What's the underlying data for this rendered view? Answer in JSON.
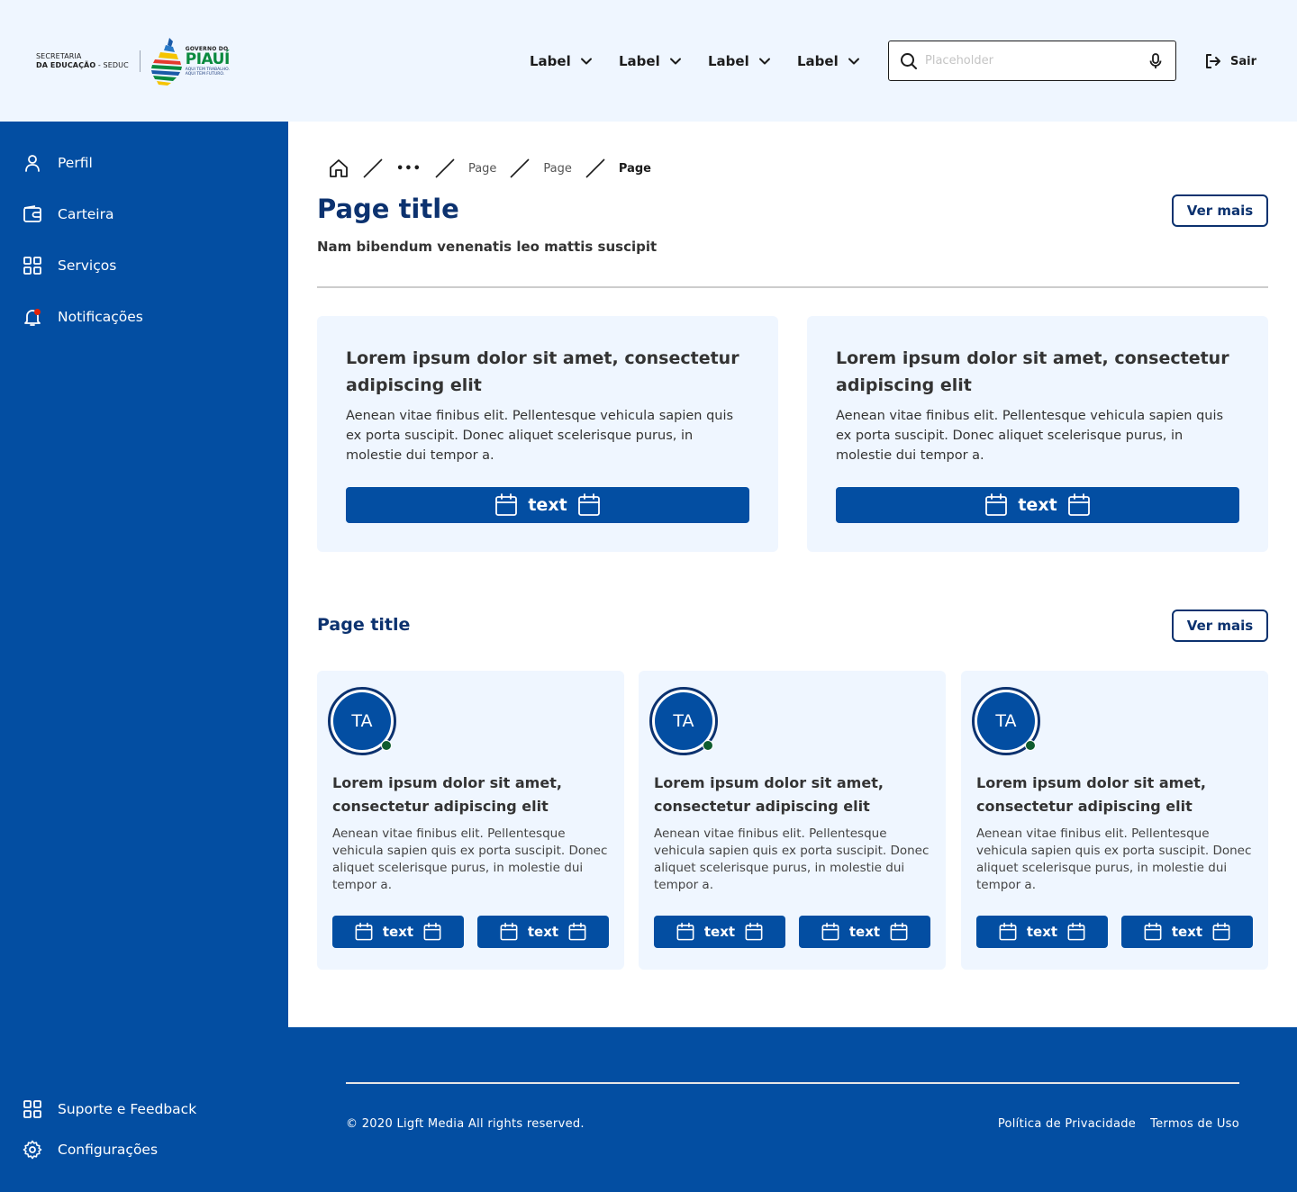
{
  "header": {
    "logo": {
      "secretaria_line1": "SECRETARIA",
      "secretaria_line2_bold": "DA EDUCAÇÃO",
      "secretaria_line2_rest": " - SEDUC",
      "gov_small": "GOVERNO DO",
      "gov_big": "PIAUÍ",
      "gov_tag1": "AQUI TEM TRABALHO.",
      "gov_tag2": "AQUI TEM FUTURO."
    },
    "nav": [
      {
        "label": "Label"
      },
      {
        "label": "Label"
      },
      {
        "label": "Label"
      },
      {
        "label": "Label"
      }
    ],
    "search": {
      "placeholder": "Placeholder",
      "value": ""
    },
    "logout_label": "Sair"
  },
  "sidebar": {
    "items": [
      {
        "label": "Perfil",
        "icon": "user-icon"
      },
      {
        "label": "Carteira",
        "icon": "wallet-icon"
      },
      {
        "label": "Serviços",
        "icon": "grid-icon"
      },
      {
        "label": "Notificações",
        "icon": "bell-icon"
      }
    ],
    "bottom_items": [
      {
        "label": "Suporte e Feedback",
        "icon": "grid-icon"
      },
      {
        "label": "Configurações",
        "icon": "gear-icon"
      }
    ]
  },
  "breadcrumb": {
    "ellipsis": "•••",
    "items": [
      "Page",
      "Page",
      "Page"
    ]
  },
  "main": {
    "title": "Page title",
    "subtitle": "Nam bibendum venenatis leo mattis suscipit",
    "ver_mais": "Ver mais",
    "cards": [
      {
        "title": "Lorem ipsum dolor sit amet, consectetur adipiscing elit",
        "text": "Aenean vitae finibus elit. Pellentesque vehicula sapien quis ex porta suscipit. Donec aliquet scelerisque purus, in molestie dui tempor a.",
        "button": "text"
      },
      {
        "title": "Lorem ipsum dolor sit amet, consectetur adipiscing elit",
        "text": "Aenean vitae finibus elit. Pellentesque vehicula sapien quis ex porta suscipit. Donec aliquet scelerisque purus, in molestie dui tempor a.",
        "button": "text"
      }
    ]
  },
  "section": {
    "title": "Page title",
    "ver_mais": "Ver mais",
    "cards": [
      {
        "avatar": "TA",
        "title": "Lorem ipsum dolor sit amet, consectetur adipiscing elit",
        "text": "Aenean vitae finibus elit. Pellentesque vehicula sapien quis ex porta suscipit. Donec aliquet scelerisque purus, in molestie dui tempor a.",
        "button1": "text",
        "button2": "text"
      },
      {
        "avatar": "TA",
        "title": "Lorem ipsum dolor sit amet, consectetur adipiscing elit",
        "text": "Aenean vitae finibus elit. Pellentesque vehicula sapien quis ex porta suscipit. Donec aliquet scelerisque purus, in molestie dui tempor a.",
        "button1": "text",
        "button2": "text"
      },
      {
        "avatar": "TA",
        "title": "Lorem ipsum dolor sit amet, consectetur adipiscing elit",
        "text": "Aenean vitae finibus elit. Pellentesque vehicula sapien quis ex porta suscipit. Donec aliquet scelerisque purus, in molestie dui tempor a.",
        "button1": "text",
        "button2": "text"
      }
    ]
  },
  "footer": {
    "copyright": "© 2020 Ligft Media All rights reserved.",
    "privacy": "Política de Privacidade",
    "terms": "Termos de Uso"
  },
  "colors": {
    "primary": "#034ea2",
    "dark_blue": "#0c326f",
    "light_bg": "#eff6ff",
    "status_online": "#0e5c2e",
    "notification_dot": "#e52207"
  }
}
